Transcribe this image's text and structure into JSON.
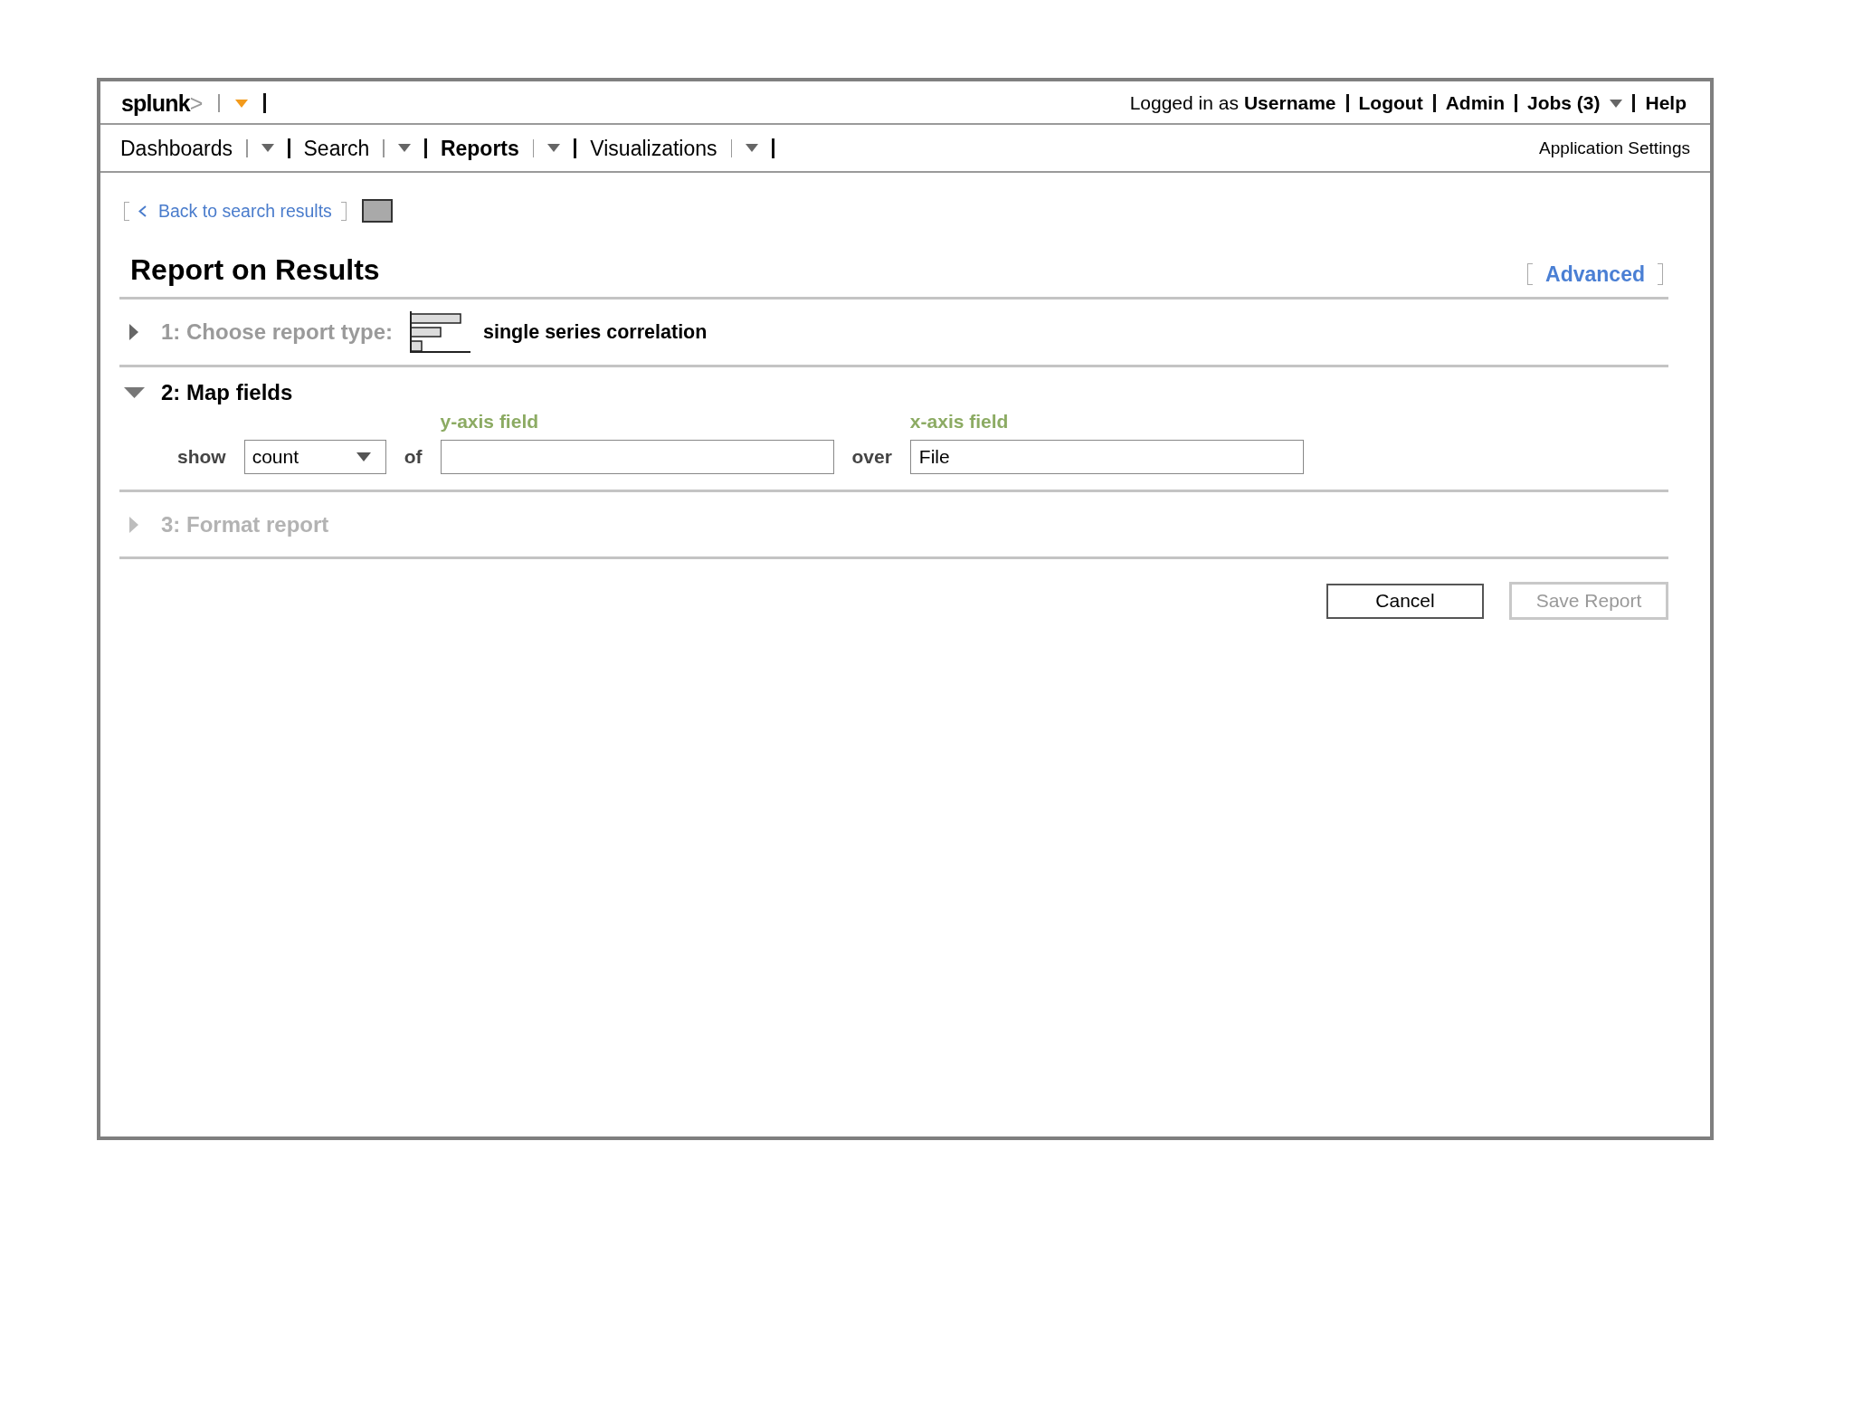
{
  "header": {
    "logo": {
      "text": "splunk",
      "mark": ">"
    },
    "login_text": "Logged in as",
    "username": "Username",
    "links": [
      {
        "label": "Logout",
        "dropdown": false
      },
      {
        "label": "Admin",
        "dropdown": false
      },
      {
        "label": "Jobs (3)",
        "dropdown": true
      },
      {
        "label": "Help",
        "dropdown": false
      }
    ]
  },
  "nav": {
    "items": [
      {
        "label": "Dashboards",
        "selected": false
      },
      {
        "label": "Search",
        "selected": false
      },
      {
        "label": "Reports",
        "selected": true
      },
      {
        "label": "Visualizations",
        "selected": false
      }
    ],
    "settings": "Application Settings"
  },
  "back_link": "Back to search results",
  "title": "Report on Results",
  "advanced_link": "Advanced",
  "steps": [
    {
      "title": "1: Choose report type:",
      "expanded": false,
      "disabled": false,
      "summary": "single series correlation"
    },
    {
      "title": "2: Map fields",
      "expanded": true,
      "disabled": false,
      "form": [
        {
          "kind": "label",
          "text": "show"
        },
        {
          "kind": "select",
          "value": "count"
        },
        {
          "kind": "label",
          "text": "of"
        },
        {
          "kind": "input",
          "caption": "y-axis field"
        },
        {
          "kind": "label",
          "text": "over"
        },
        {
          "kind": "input",
          "caption": "x-axis field",
          "value": "File"
        }
      ]
    },
    {
      "title": "3: Format report",
      "expanded": false,
      "disabled": true
    }
  ],
  "buttons": [
    {
      "label": "Cancel",
      "disabled": false
    },
    {
      "label": "Save Report",
      "disabled": true
    }
  ]
}
